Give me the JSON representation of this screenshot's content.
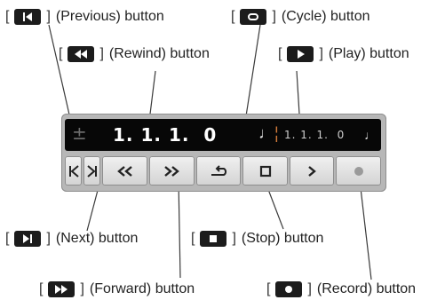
{
  "callouts": {
    "previous": "(Previous) button",
    "cycle": "(Cycle) button",
    "rewind": "(Rewind) button",
    "play": "(Play) button",
    "next": "(Next) button",
    "stop": "(Stop) button",
    "forward": "(Forward) button",
    "record": "(Record) button"
  },
  "brackets": {
    "open": "[",
    "close": "]"
  },
  "display": {
    "position_main": "1.  1.  1.",
    "position_main_value": "0",
    "position_small": "1.  1.  1.",
    "position_small_value": "0",
    "plus_minus": "±"
  },
  "icons": {
    "previous": "previous-icon",
    "next": "next-icon",
    "rewind": "rewind-icon",
    "forward": "forward-icon",
    "cycle": "cycle-icon",
    "stop": "stop-icon",
    "play": "play-icon",
    "record": "record-icon"
  },
  "colors": {
    "panel": "#b7b7b7",
    "lcd": "#070707",
    "chip": "#1c1c1c",
    "record_dot": "#9a9a9a"
  }
}
